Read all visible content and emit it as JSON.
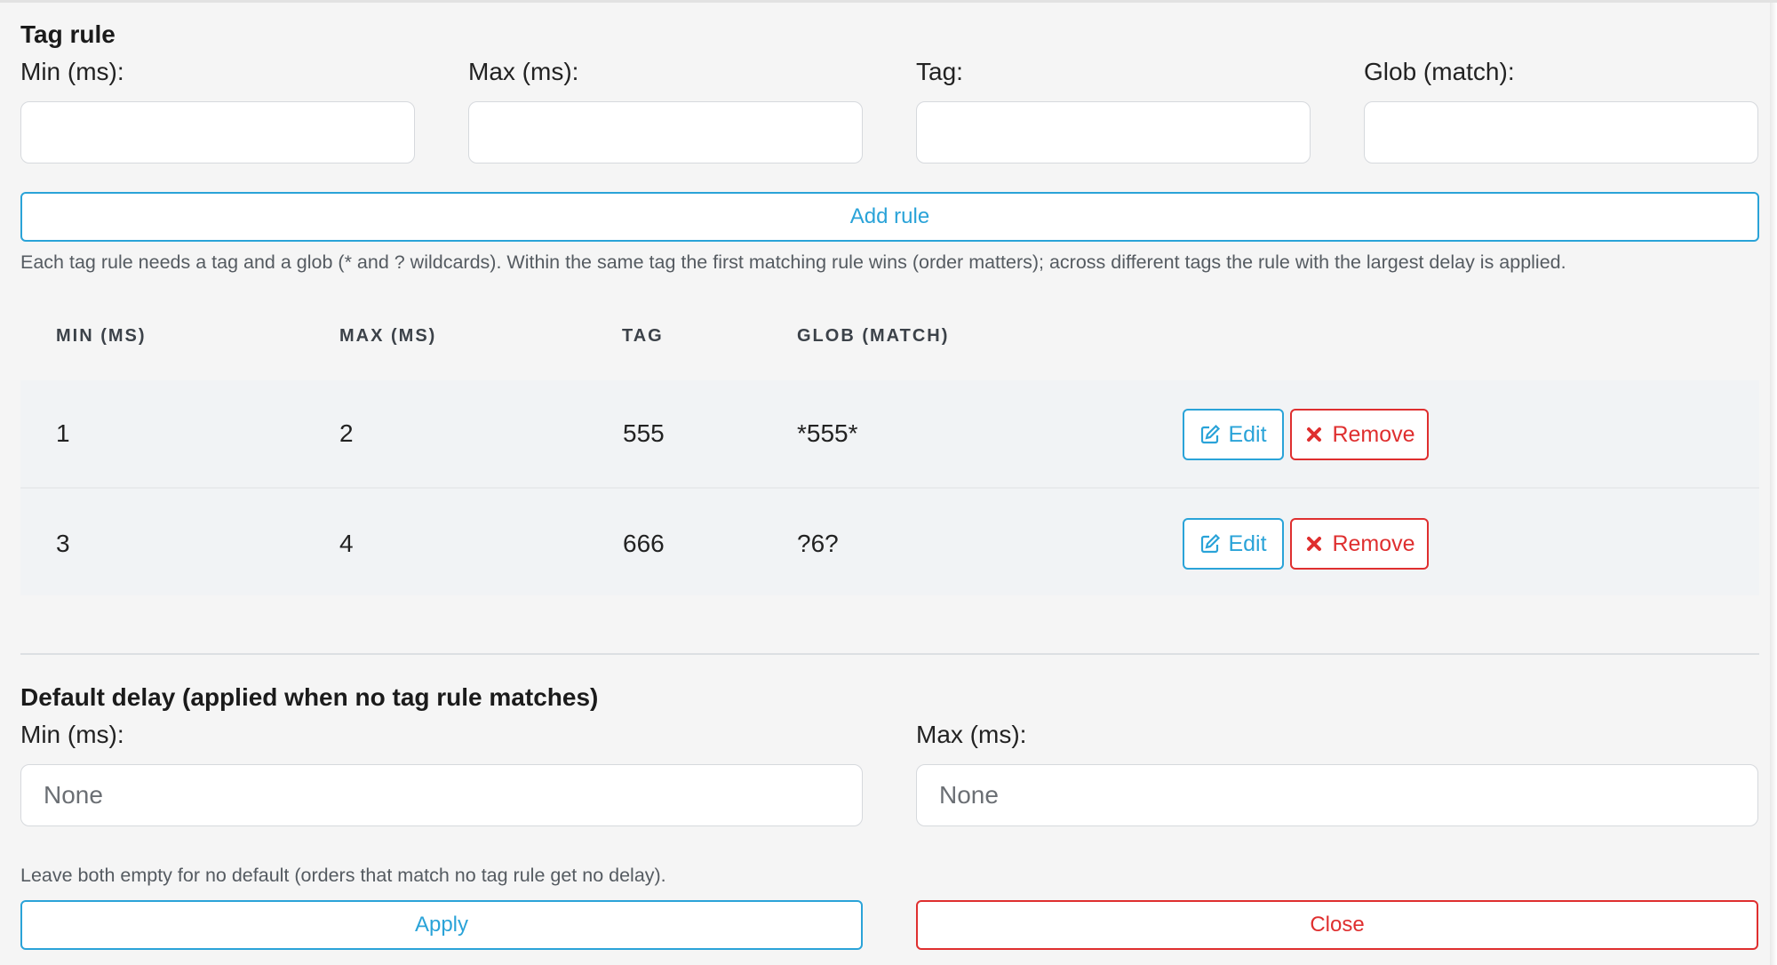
{
  "tag_rule": {
    "title": "Tag rule",
    "min_label": "Min (ms):",
    "max_label": "Max (ms):",
    "tag_label": "Tag:",
    "glob_label": "Glob (match):",
    "min_value": "",
    "max_value": "",
    "tag_value": "",
    "glob_value": "",
    "add_button": "Add rule",
    "help": "Each tag rule needs a tag and a glob (* and ? wildcards). Within the same tag the first matching rule wins (order matters); across different tags the rule with the largest delay is applied."
  },
  "table": {
    "headers": [
      "MIN (MS)",
      "MAX (MS)",
      "TAG",
      "GLOB (MATCH)"
    ],
    "rows": [
      {
        "min": "1",
        "max": "2",
        "tag": "555",
        "glob": "*555*",
        "edit": "Edit",
        "remove": "Remove"
      },
      {
        "min": "3",
        "max": "4",
        "tag": "666",
        "glob": "?6?",
        "edit": "Edit",
        "remove": "Remove"
      }
    ]
  },
  "default_delay": {
    "title": "Default delay (applied when no tag rule matches)",
    "min_label": "Min (ms):",
    "max_label": "Max (ms):",
    "min_placeholder": "None",
    "max_placeholder": "None",
    "help": "Leave both empty for no default (orders that match no tag rule get no delay).",
    "apply_button": "Apply",
    "close_button": "Close"
  },
  "icons": {
    "edit": "edit-icon",
    "remove": "times-icon"
  },
  "colors": {
    "info": "#2aa3d8",
    "danger": "#df2f2f",
    "panel_bg": "#f5f5f5"
  }
}
